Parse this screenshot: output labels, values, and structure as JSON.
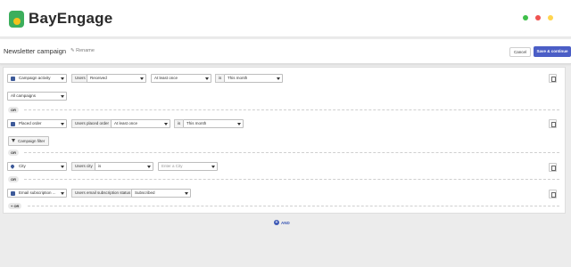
{
  "brand": {
    "name": "BayEngage"
  },
  "window_dots": {
    "colors": [
      "#3fbf4a",
      "#ef5350",
      "#ffd54f"
    ]
  },
  "header": {
    "title": "Newsletter campaign",
    "rename": "Rename",
    "cancel_label": "Cancel",
    "save_label": "Save & continue"
  },
  "rows": {
    "r1": {
      "type": "Campaign activity",
      "label": "Users",
      "op1": "Received",
      "op2": "At least once",
      "is_label": "is",
      "period": "This month",
      "extra": "All campaigns",
      "or_label": "OR"
    },
    "r2": {
      "type": "Placed order",
      "label": "Users placed order",
      "op2": "At least once",
      "is_label": "is",
      "period": "This month",
      "filter_label": "Campaign filter",
      "or_label": "OR"
    },
    "r3": {
      "type": "City",
      "label": "Users city",
      "op1": "is",
      "placeholder": "Enter a City",
      "or_label": "OR"
    },
    "r4": {
      "type": "Email subscription ...",
      "label": "Users email subscription status",
      "value": "Subscribed",
      "or_label": "+ OR"
    }
  },
  "footer": {
    "and_label": "AND"
  }
}
